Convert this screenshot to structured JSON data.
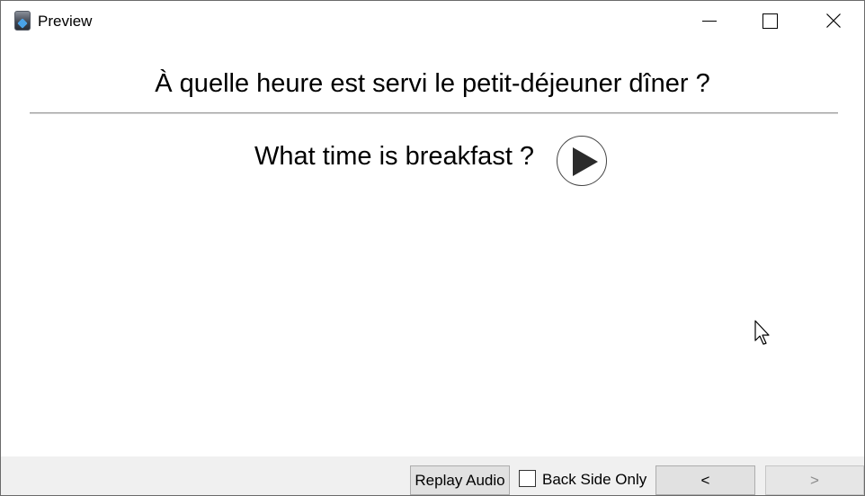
{
  "window": {
    "title": "Preview",
    "icon": "app-icon",
    "controls": {
      "minimize": "minimize-icon",
      "maximize": "maximize-icon",
      "close": "close-icon"
    }
  },
  "card": {
    "front_text": "À quelle heure est servi le petit-déjeuner dîner ?",
    "back_text": "What time is breakfast ?",
    "audio_icon": "play-icon"
  },
  "footer": {
    "replay_label": "Replay Audio",
    "back_side_only_label": "Back Side Only",
    "back_side_only_checked": false,
    "prev_label": "<",
    "next_label": ">",
    "next_enabled": false
  }
}
